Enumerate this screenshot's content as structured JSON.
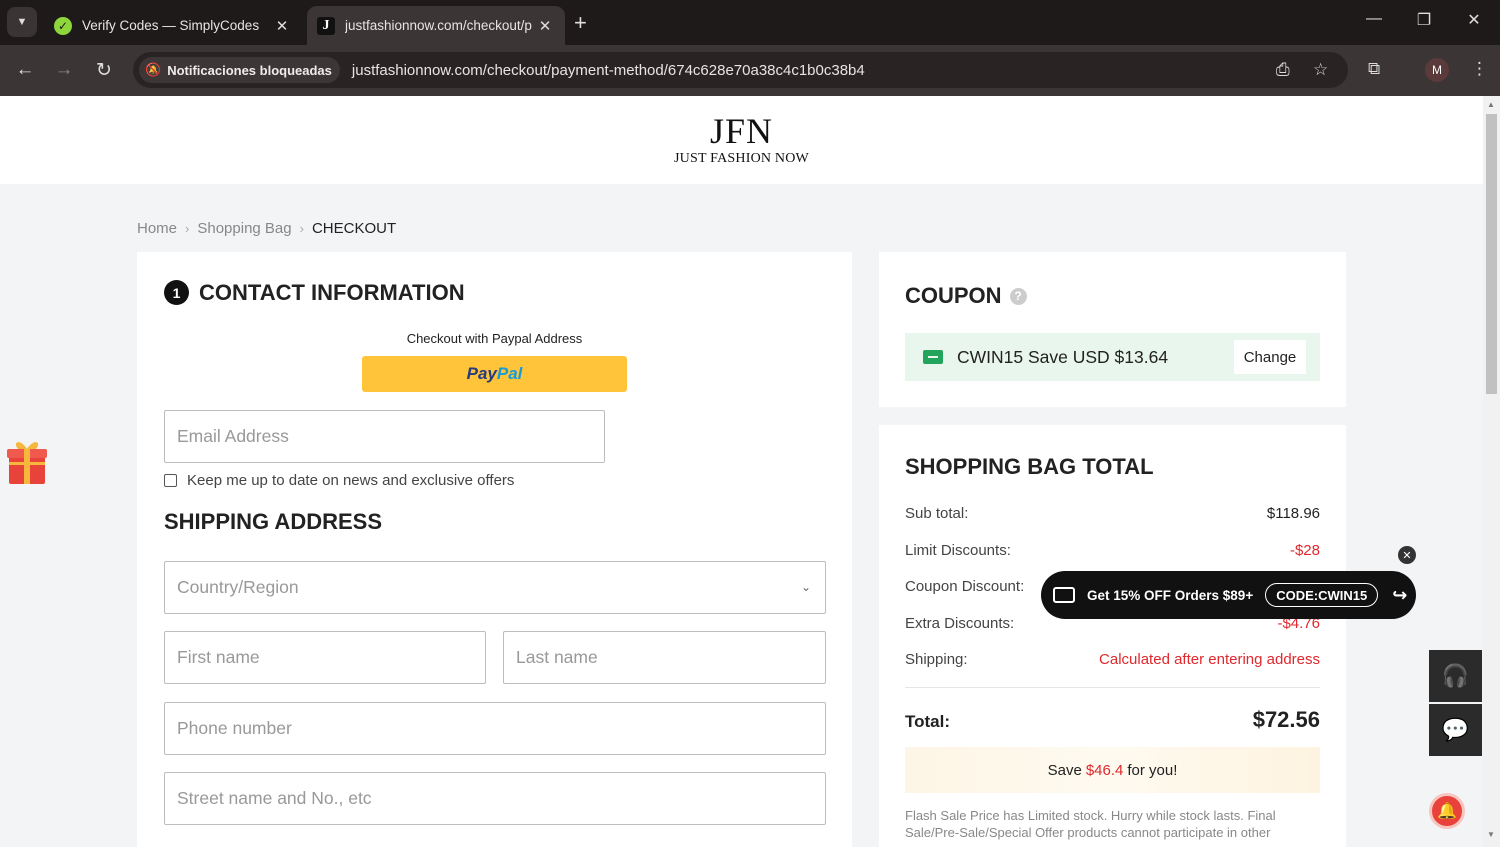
{
  "browser": {
    "tabs": [
      {
        "title": "Verify Codes — SimplyCodes",
        "active": false
      },
      {
        "title": "justfashionnow.com/checkout/p",
        "active": true
      }
    ],
    "notifications_chip": "Notificaciones bloqueadas",
    "url": "justfashionnow.com/checkout/payment-method/674c628e70a38c4c1b0c38b4",
    "profile_initial": "M"
  },
  "logo": {
    "main": "JFN",
    "sub": "JUST FASHION NOW"
  },
  "breadcrumb": {
    "home": "Home",
    "bag": "Shopping Bag",
    "current": "CHECKOUT"
  },
  "contact": {
    "step": "1",
    "heading": "CONTACT INFORMATION",
    "paypal_label": "Checkout with Paypal Address",
    "paypal_a": "Pay",
    "paypal_b": "Pal",
    "email_placeholder": "Email Address",
    "newsletter_label": "Keep me up to date on news and exclusive offers"
  },
  "shipping": {
    "heading": "SHIPPING ADDRESS",
    "country_placeholder": "Country/Region",
    "first_name_placeholder": "First name",
    "last_name_placeholder": "Last name",
    "phone_placeholder": "Phone number",
    "street_placeholder": "Street name and No., etc"
  },
  "coupon": {
    "heading": "COUPON",
    "applied_text": "CWIN15 Save USD $13.64",
    "change_label": "Change"
  },
  "totals": {
    "heading": "SHOPPING BAG TOTAL",
    "rows": [
      {
        "label": "Sub total:",
        "value": "$118.96"
      },
      {
        "label": "Limit Discounts:",
        "value": "-$28"
      },
      {
        "label": "Coupon Discount:",
        "value": ""
      },
      {
        "label": "Extra Discounts:",
        "value": "-$4.76"
      },
      {
        "label": "Shipping:",
        "value": "Calculated after entering address"
      }
    ],
    "total_label": "Total:",
    "total_value": "$72.56",
    "save_prefix": "Save",
    "save_amount": "$46.4",
    "save_suffix": "for you!",
    "flash_note": "Flash Sale Price has Limited stock. Hurry while stock lasts. Final Sale/Pre-Sale/Special Offer products cannot participate in other"
  },
  "promo": {
    "text": "Get 15% OFF Orders $89+",
    "code": "CODE:CWIN15"
  },
  "colors": {
    "accent_red": "#e0282d",
    "paypal_yellow": "#ffc439",
    "coupon_green": "#22a45d"
  }
}
